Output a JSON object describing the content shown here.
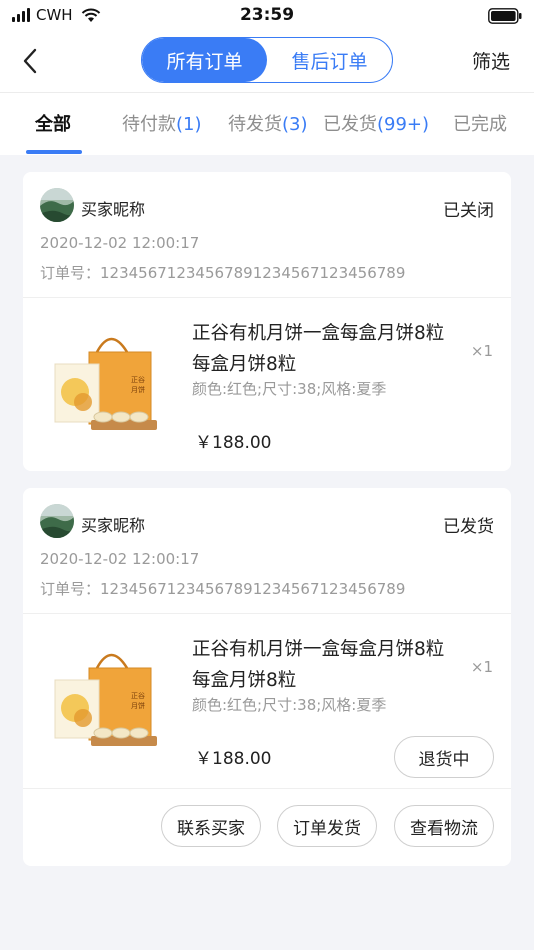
{
  "status_bar": {
    "carrier": "CWH",
    "time": "23:59"
  },
  "nav": {
    "segments": [
      "所有订单",
      "售后订单"
    ],
    "filter_label": "筛选"
  },
  "tabs": [
    {
      "label": "全部",
      "count": ""
    },
    {
      "label": "待付款",
      "count": "(1)"
    },
    {
      "label": "待发货",
      "count": "(3)"
    },
    {
      "label": "已发货",
      "count": "(99+)"
    },
    {
      "label": "已完成",
      "count": ""
    }
  ],
  "orders": [
    {
      "buyer": "买家昵称",
      "status": "已关闭",
      "date": "2020-12-02 12:00:17",
      "order_no": "订单号：12345671234567891234567123456789",
      "product": {
        "title": "正谷有机月饼一盒每盒月饼8粒每盒月饼8粒",
        "spec": "颜色:红色;尺寸:38;风格:夏季",
        "qty": "×1",
        "price": "￥188.00"
      }
    },
    {
      "buyer": "买家昵称",
      "status": "已发货",
      "date": "2020-12-02 12:00:17",
      "order_no": "订单号：12345671234567891234567123456789",
      "product": {
        "title": "正谷有机月饼一盒每盒月饼8粒每盒月饼8粒",
        "spec": "颜色:红色;尺寸:38;风格:夏季",
        "qty": "×1",
        "price": "￥188.00",
        "return_label": "退货中"
      },
      "actions": [
        "联系买家",
        "订单发货",
        "查看物流"
      ]
    }
  ],
  "colors": {
    "accent": "#3a7cf5",
    "background": "#f3f4f8"
  }
}
